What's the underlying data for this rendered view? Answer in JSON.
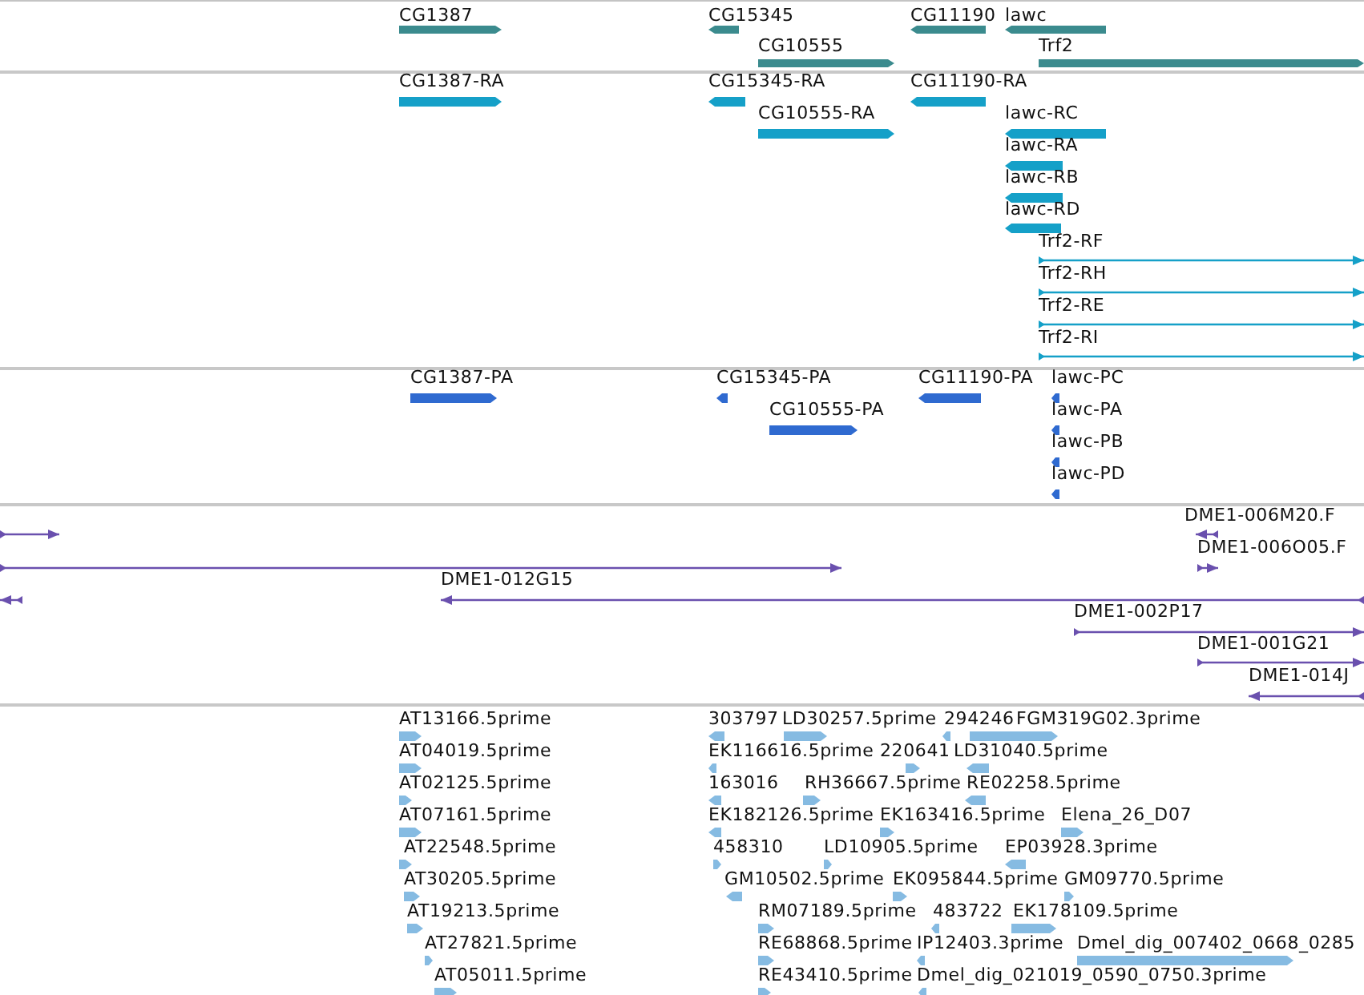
{
  "tracks": [
    {
      "kind": "gene",
      "features": [
        {
          "label": "CG1387",
          "reverse": false
        },
        {
          "label": "CG15345",
          "reverse": true
        },
        {
          "label": "CG11190",
          "reverse": true
        },
        {
          "label": "lawc",
          "reverse": true
        },
        {
          "label": "CG10555",
          "reverse": false
        },
        {
          "label": "Trf2",
          "reverse": false
        }
      ]
    },
    {
      "kind": "transcript",
      "features": [
        {
          "label": "CG1387-RA",
          "reverse": false
        },
        {
          "label": "CG15345-RA",
          "reverse": true
        },
        {
          "label": "CG11190-RA",
          "reverse": true
        },
        {
          "label": "CG10555-RA",
          "reverse": false
        },
        {
          "label": "lawc-RC",
          "reverse": true
        },
        {
          "label": "lawc-RA",
          "reverse": true
        },
        {
          "label": "lawc-RB",
          "reverse": true
        },
        {
          "label": "lawc-RD",
          "reverse": true
        },
        {
          "label": "Trf2-RF",
          "reverse": false
        },
        {
          "label": "Trf2-RH",
          "reverse": false
        },
        {
          "label": "Trf2-RE",
          "reverse": false
        },
        {
          "label": "Trf2-RI",
          "reverse": false
        }
      ]
    },
    {
      "kind": "protein",
      "features": [
        {
          "label": "CG1387-PA",
          "reverse": false
        },
        {
          "label": "CG15345-PA",
          "reverse": true
        },
        {
          "label": "CG11190-PA",
          "reverse": true
        },
        {
          "label": "lawc-PC",
          "reverse": true
        },
        {
          "label": "CG10555-PA",
          "reverse": false
        },
        {
          "label": "lawc-PA",
          "reverse": true
        },
        {
          "label": "lawc-PB",
          "reverse": true
        },
        {
          "label": "lawc-PD",
          "reverse": true
        }
      ]
    },
    {
      "kind": "clone",
      "features": [
        {
          "reverse": false
        },
        {
          "reverse": false
        },
        {
          "reverse": true
        },
        {
          "label": "DME1-006M20.F",
          "reverse": true
        },
        {
          "label": "DME1-006O05.F",
          "reverse": false
        },
        {
          "label": "DME1-012G15",
          "reverse": true
        },
        {
          "label": "DME1-002P17",
          "reverse": false
        },
        {
          "label": "DME1-001G21",
          "reverse": false
        },
        {
          "label": "DME1-014J",
          "reverse": true
        }
      ]
    },
    {
      "kind": "est",
      "features": [
        {
          "label": "AT13166.5prime",
          "reverse": false
        },
        {
          "label": "303797",
          "reverse": true
        },
        {
          "label": "LD30257.5prime",
          "reverse": false
        },
        {
          "label": "294246",
          "reverse": true
        },
        {
          "label": "FGM319G02.3prime",
          "reverse": false
        },
        {
          "label": "AT04019.5prime",
          "reverse": false
        },
        {
          "label": "EK116616.5prime",
          "reverse": true
        },
        {
          "label": "220641",
          "reverse": false
        },
        {
          "label": "LD31040.5prime",
          "reverse": true
        },
        {
          "label": "AT02125.5prime",
          "reverse": false
        },
        {
          "label": "163016",
          "reverse": true
        },
        {
          "label": "RH36667.5prime",
          "reverse": false
        },
        {
          "label": "RE02258.5prime",
          "reverse": true
        },
        {
          "label": "AT07161.5prime",
          "reverse": false
        },
        {
          "label": "EK182126.5prime",
          "reverse": true
        },
        {
          "label": "EK163416.5prime",
          "reverse": false
        },
        {
          "label": "Elena_26_D07",
          "reverse": false
        },
        {
          "label": "AT22548.5prime",
          "reverse": false
        },
        {
          "label": "458310",
          "reverse": false
        },
        {
          "label": "LD10905.5prime",
          "reverse": false
        },
        {
          "label": "EP03928.3prime",
          "reverse": true
        },
        {
          "label": "AT30205.5prime",
          "reverse": false
        },
        {
          "label": "GM10502.5prime",
          "reverse": true
        },
        {
          "label": "EK095844.5prime",
          "reverse": false
        },
        {
          "label": "GM09770.5prime",
          "reverse": false
        },
        {
          "label": "AT19213.5prime",
          "reverse": false
        },
        {
          "label": "RM07189.5prime",
          "reverse": false
        },
        {
          "label": "483722",
          "reverse": true
        },
        {
          "label": "EK178109.5prime",
          "reverse": false
        },
        {
          "label": "AT27821.5prime",
          "reverse": false
        },
        {
          "label": "RE68868.5prime",
          "reverse": false
        },
        {
          "label": "IP12403.3prime",
          "reverse": true
        },
        {
          "label": "Dmel_dig_007402_0668_0285",
          "reverse": false
        },
        {
          "label": "AT05011.5prime",
          "reverse": false
        },
        {
          "label": "RE43410.5prime",
          "reverse": false
        },
        {
          "label": "Dmel_dig_021019_0590_0750.3prime",
          "reverse": true
        }
      ]
    }
  ]
}
